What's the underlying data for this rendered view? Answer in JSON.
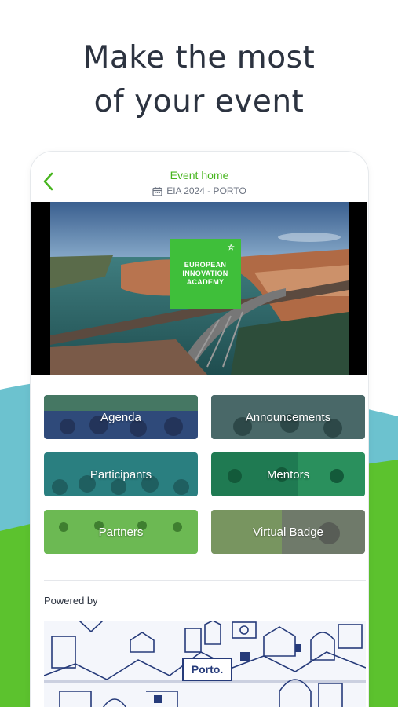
{
  "headline": {
    "line1": "Make the most",
    "line2": "of your event"
  },
  "header": {
    "back_icon": "chevron-left-icon",
    "title": "Event home",
    "calendar_icon": "calendar-icon",
    "event_name": "EIA 2024 - PORTO"
  },
  "hero": {
    "logo_line1": "EUROPEAN",
    "logo_line2": "INNOVATION",
    "logo_line3": "ACADEMY",
    "logo_star": "☆"
  },
  "tiles": [
    {
      "label": "Agenda"
    },
    {
      "label": "Announcements"
    },
    {
      "label": "Participants"
    },
    {
      "label": "Mentors"
    },
    {
      "label": "Partners"
    },
    {
      "label": "Virtual Badge"
    }
  ],
  "powered_by": "Powered by",
  "sponsor": {
    "label": "Porto."
  },
  "colors": {
    "accent_green": "#47b51e",
    "wave_teal": "#6cc2cf",
    "wave_green": "#5cc22e",
    "headline_text": "#2c3340"
  }
}
